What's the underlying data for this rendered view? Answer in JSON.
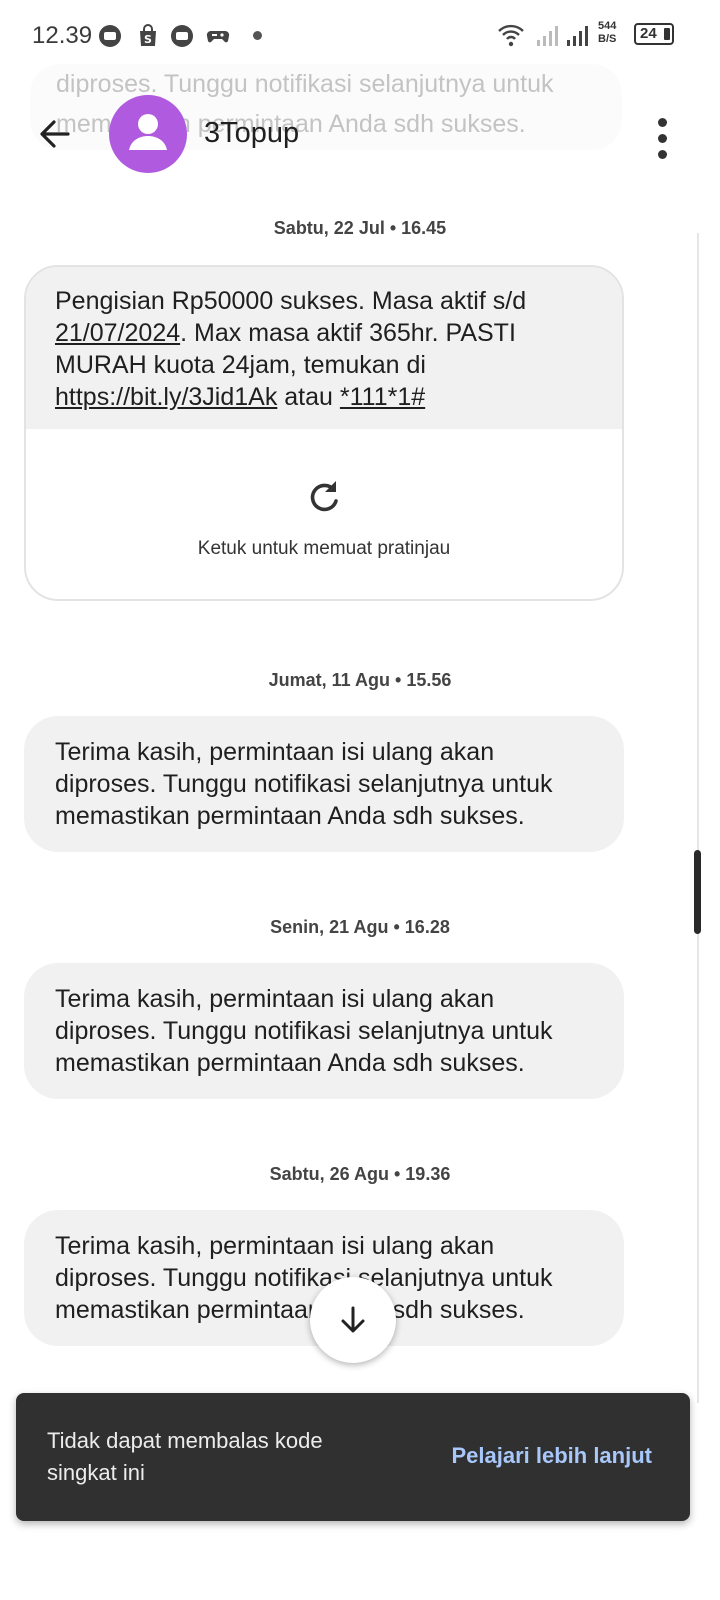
{
  "status_bar": {
    "time": "12.39",
    "net_speed_value": "544",
    "net_speed_unit": "B/S",
    "battery": "24",
    "icons": [
      "chat-bubble-icon",
      "shop-bag-icon",
      "chat-bubble-icon",
      "gamepad-icon",
      "wifi-icon",
      "signal-icon",
      "signal-icon"
    ]
  },
  "header": {
    "contact_name": "3Topup",
    "avatar_color": "#b05ae0"
  },
  "ghost_text": {
    "line1": "diproses. Tunggu notifikasi selanjutnya untuk",
    "line2": "memastikan permintaan Anda sdh sukses."
  },
  "messages": [
    {
      "date": "Sabtu, 22 Jul • 16.45",
      "segments": {
        "s1": "Pengisian Rp50000 sukses. Masa aktif s/d ",
        "s2": "21/07/2024",
        "s3": ". Max masa aktif 365hr. PASTI MURAH kuota 24jam, temukan di ",
        "s4": "https://bit.ly/3Jid1Ak",
        "s5": " atau ",
        "s6": "*111*1#"
      },
      "preview_label": "Ketuk untuk memuat pratinjau"
    },
    {
      "date": "Jumat, 11 Agu • 15.56",
      "text": "Terima kasih, permintaan isi ulang akan diproses. Tunggu notifikasi selanjutnya untuk memastikan permintaan Anda sdh sukses."
    },
    {
      "date": "Senin, 21 Agu • 16.28",
      "text": "Terima kasih, permintaan isi ulang akan diproses. Tunggu notifikasi selanjutnya untuk memastikan permintaan Anda sdh sukses."
    },
    {
      "date": "Sabtu, 26 Agu • 19.36",
      "text": "Terima kasih, permintaan isi ulang akan diproses. Tunggu notifikasi selanjutnya untuk memastikan permintaan Anda sdh sukses."
    }
  ],
  "snackbar": {
    "message": "Tidak dapat membalas kode singkat ini",
    "action": "Pelajari lebih lanjut",
    "action_color": "#a8c7fa"
  }
}
